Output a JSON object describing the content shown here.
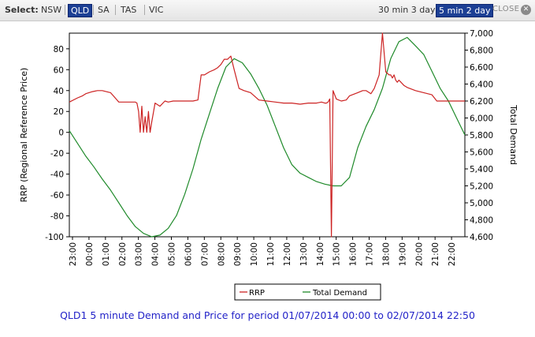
{
  "toolbar": {
    "select_label": "Select:",
    "regions": [
      "NSW",
      "QLD",
      "SA",
      "TAS",
      "VIC"
    ],
    "active_region": "QLD",
    "periods": [
      "30 min 3 day",
      "5 min 2 day"
    ],
    "active_period": "5 min 2 day",
    "close_label": "CLOSE",
    "close_icon": "close-icon"
  },
  "chart_data": {
    "type": "line",
    "title": "QLD1 5 minute Demand and Price for period 01/07/2014 00:00 to 02/07/2014 22:50",
    "ylabel": "RRP (Regional Reference Price)",
    "y2label": "Total Demand",
    "ylim": [
      -100,
      95
    ],
    "y2lim": [
      4600,
      7000
    ],
    "yticks": [
      -100,
      -80,
      -60,
      -40,
      -20,
      0,
      20,
      40,
      60,
      80
    ],
    "y2ticks": [
      4600,
      4800,
      5000,
      5200,
      5400,
      5600,
      5800,
      6000,
      6200,
      6400,
      6600,
      6800,
      7000
    ],
    "y2tick_labels": [
      "4,600",
      "4,800",
      "5,000",
      "5,200",
      "5,400",
      "5,600",
      "5,800",
      "6,000",
      "6,200",
      "6,400",
      "6,600",
      "6,800",
      "7,000"
    ],
    "xlim": [
      0,
      24
    ],
    "xticks": [
      0,
      1,
      2,
      3,
      4,
      5,
      6,
      7,
      8,
      9,
      10,
      11,
      12,
      13,
      14,
      15,
      16,
      17,
      18,
      19,
      20,
      21,
      22,
      23
    ],
    "xtick_labels": [
      "23:00",
      "00:00",
      "01:00",
      "02:00",
      "03:00",
      "04:00",
      "05:00",
      "06:00",
      "07:00",
      "08:00",
      "09:00",
      "10:00",
      "11:00",
      "12:00",
      "13:00",
      "14:00",
      "15:00",
      "16:00",
      "17:00",
      "18:00",
      "19:00",
      "20:00",
      "21:00",
      "22:00"
    ],
    "legend_position": "bottom",
    "series": [
      {
        "name": "RRP",
        "axis": "left",
        "color": "#cc2222",
        "x": [
          0,
          0.5,
          0.8,
          1.0,
          1.4,
          1.7,
          2.0,
          2.5,
          3.0,
          3.3,
          3.4,
          3.5,
          3.6,
          3.7,
          3.8,
          3.9,
          4.0,
          4.1,
          4.2,
          4.3,
          4.4,
          4.5,
          4.6,
          4.7,
          4.8,
          4.9,
          5.0,
          5.2,
          5.5,
          5.8,
          6.0,
          6.3,
          6.6,
          6.8,
          7.0,
          7.5,
          7.8,
          8.0,
          8.2,
          8.5,
          8.8,
          9.0,
          9.2,
          9.4,
          9.6,
          9.8,
          10.0,
          10.3,
          10.6,
          11.0,
          11.5,
          12.0,
          12.5,
          13.0,
          13.5,
          14.0,
          14.5,
          15.0,
          15.3,
          15.5,
          15.6,
          15.7,
          15.8,
          15.9,
          16.0,
          16.2,
          16.5,
          16.8,
          17.0,
          17.5,
          17.8,
          18.0,
          18.3,
          18.5,
          18.8,
          19.0,
          19.2,
          19.4,
          19.5,
          19.6,
          19.7,
          19.8,
          19.9,
          20.0,
          20.3,
          20.5,
          21.0,
          21.5,
          22.0,
          22.3,
          22.5,
          22.8,
          23.0,
          23.5,
          24.0
        ],
        "values": [
          29,
          33,
          35,
          37,
          39,
          40,
          40,
          38,
          29,
          29,
          29,
          29,
          29,
          29,
          29,
          29,
          29,
          28,
          20,
          0,
          25,
          0,
          15,
          0,
          20,
          0,
          10,
          28,
          25,
          30,
          29,
          30,
          30,
          30,
          30,
          30,
          31,
          55,
          55,
          58,
          60,
          62,
          65,
          70,
          70,
          73,
          60,
          42,
          40,
          38,
          31,
          30,
          29,
          28,
          28,
          27,
          28,
          28,
          29,
          28,
          28,
          29,
          32,
          -100,
          40,
          32,
          30,
          31,
          35,
          38,
          40,
          40,
          37,
          42,
          55,
          95,
          58,
          55,
          55,
          52,
          55,
          50,
          48,
          50,
          45,
          43,
          40,
          38,
          36,
          30,
          30,
          30,
          30,
          30,
          30
        ]
      },
      {
        "name": "Total Demand",
        "axis": "right",
        "color": "#1f8a2a",
        "x": [
          0,
          0.5,
          1.0,
          1.5,
          2.0,
          2.5,
          3.0,
          3.5,
          4.0,
          4.5,
          5.0,
          5.5,
          6.0,
          6.5,
          7.0,
          7.5,
          8.0,
          8.5,
          9.0,
          9.5,
          10.0,
          10.5,
          11.0,
          11.5,
          12.0,
          12.5,
          13.0,
          13.5,
          14.0,
          14.5,
          15.0,
          15.5,
          16.0,
          16.5,
          17.0,
          17.5,
          18.0,
          18.5,
          19.0,
          19.5,
          20.0,
          20.5,
          21.0,
          21.5,
          22.0,
          22.5,
          23.0,
          23.5,
          24.0
        ],
        "values": [
          5850,
          5700,
          5550,
          5420,
          5280,
          5150,
          5000,
          4850,
          4720,
          4640,
          4600,
          4620,
          4700,
          4850,
          5100,
          5400,
          5750,
          6050,
          6350,
          6600,
          6700,
          6650,
          6520,
          6350,
          6150,
          5900,
          5650,
          5450,
          5350,
          5300,
          5250,
          5220,
          5200,
          5200,
          5300,
          5650,
          5900,
          6100,
          6350,
          6700,
          6900,
          6950,
          6850,
          6750,
          6550,
          6350,
          6200,
          6000,
          5800
        ]
      }
    ]
  }
}
